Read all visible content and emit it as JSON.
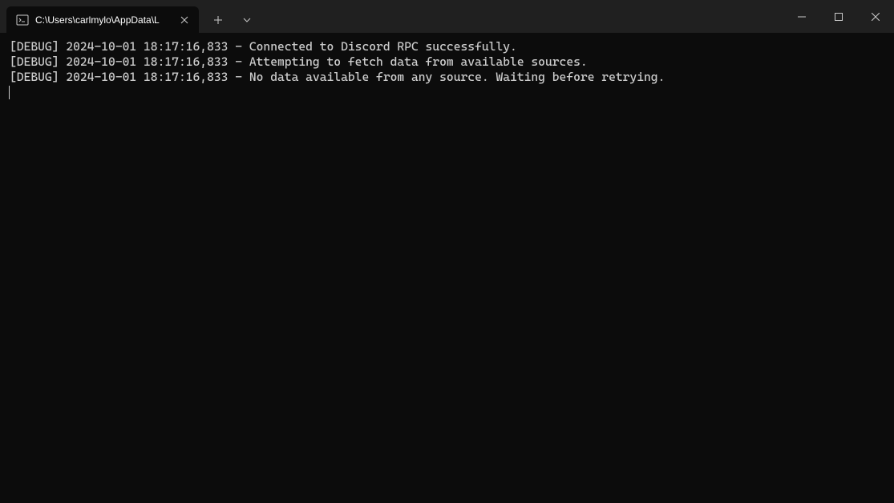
{
  "tab": {
    "title": "C:\\Users\\carlmylo\\AppData\\L"
  },
  "terminal": {
    "lines": [
      "[DEBUG] 2024-10-01 18:17:16,833 - Connected to Discord RPC successfully.",
      "[DEBUG] 2024-10-01 18:17:16,833 - Attempting to fetch data from available sources.",
      "[DEBUG] 2024-10-01 18:17:16,833 - No data available from any source. Waiting before retrying."
    ]
  }
}
